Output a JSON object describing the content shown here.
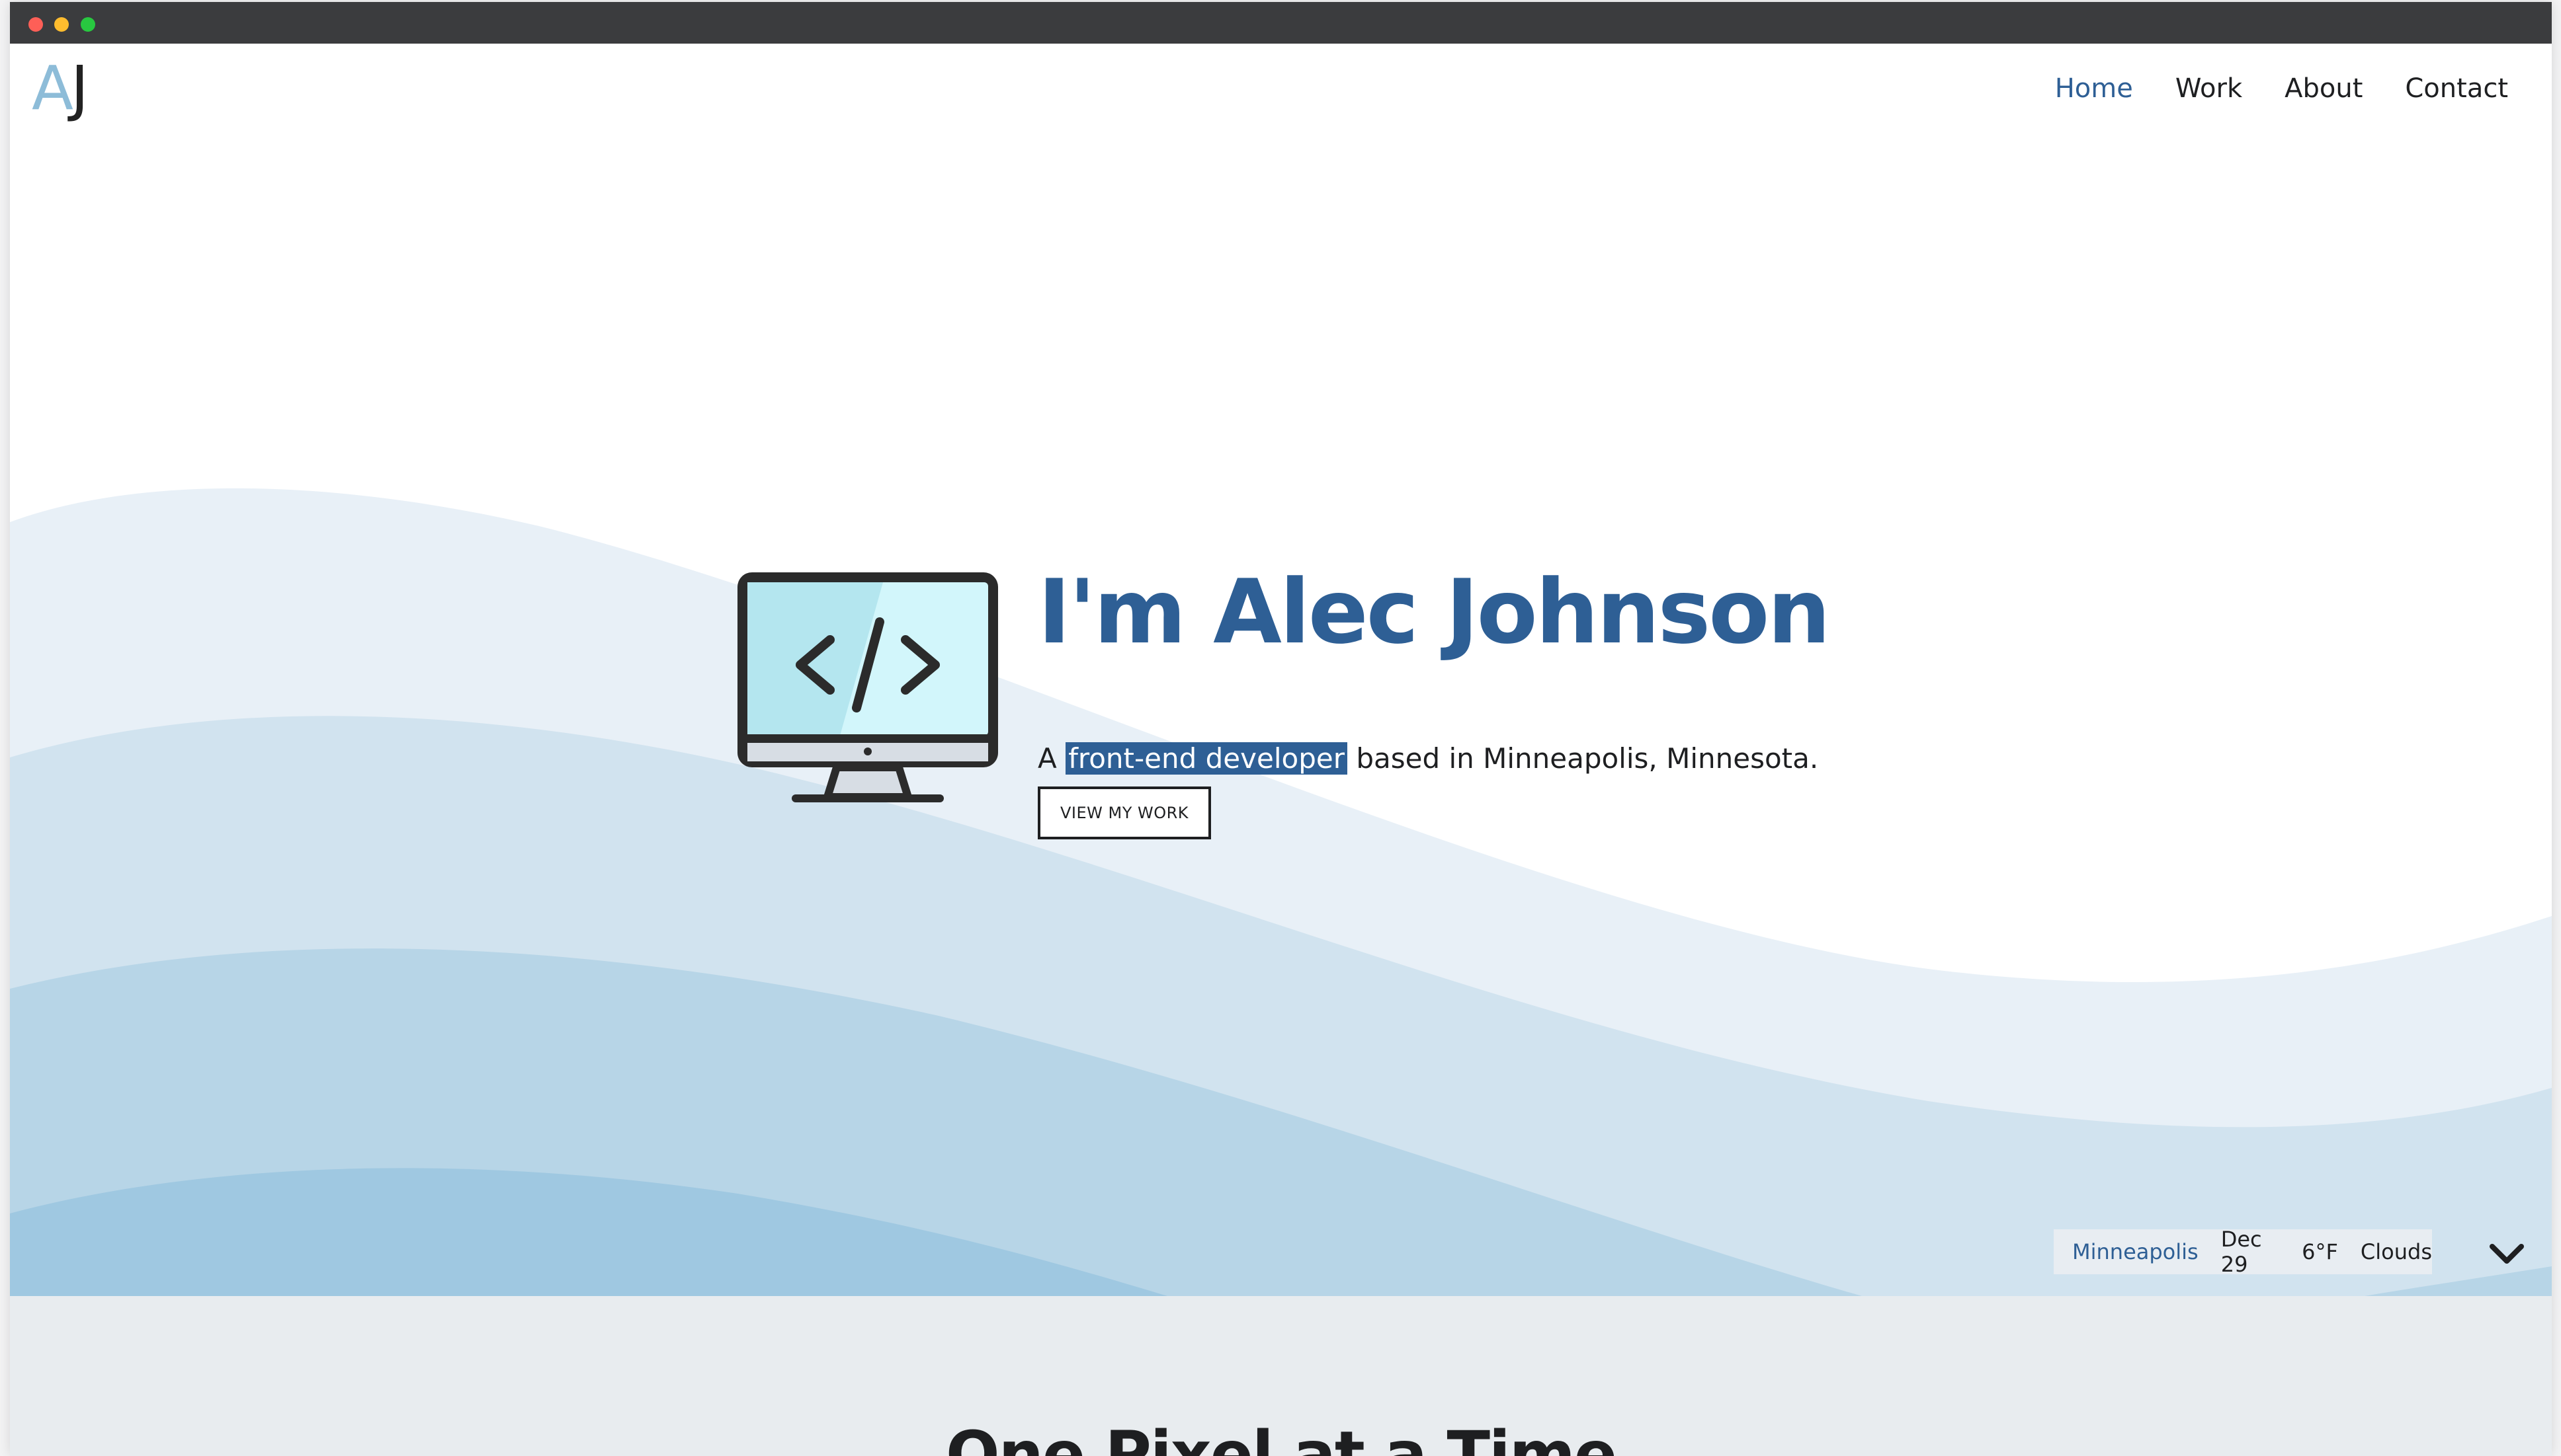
{
  "logo": {
    "letter_a": "A",
    "letter_j": "J"
  },
  "nav": {
    "items": [
      {
        "label": "Home",
        "active": true
      },
      {
        "label": "Work",
        "active": false
      },
      {
        "label": "About",
        "active": false
      },
      {
        "label": "Contact",
        "active": false
      }
    ]
  },
  "hero": {
    "headline": "I'm Alec Johnson",
    "tagline_prefix": "A",
    "tagline_highlight": "front-end developer",
    "tagline_suffix": "based in Minneapolis, Minnesota.",
    "cta_label": "VIEW MY WORK",
    "illustration_icon": "monitor-code-icon"
  },
  "weather": {
    "city": "Minneapolis",
    "date": "Dec 29",
    "temp": "6°F",
    "condition": "Clouds"
  },
  "scroll_icon": "chevron-down-icon",
  "section2": {
    "title": "One Pixel at a Time"
  },
  "colors": {
    "accent": "#2e5f95",
    "logo_a": "#8dbcd8",
    "text": "#1e1f21",
    "wave_1": "#e8f0f7",
    "wave_2": "#d1e3ef",
    "wave_3": "#b7d5e7",
    "wave_4": "#9fc8e1",
    "section2_bg": "#e8ecef"
  }
}
